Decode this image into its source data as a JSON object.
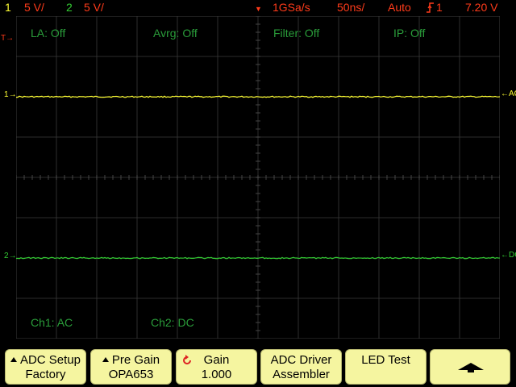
{
  "status": {
    "ch1_num": "1",
    "ch1_scale": "5 V/",
    "ch2_num": "2",
    "ch2_scale": "5 V/",
    "sample_rate": "1GSa/s",
    "timebase": "50ns/",
    "trigger_mode": "Auto",
    "trigger_source": "1",
    "trigger_level": "7.20 V"
  },
  "overlay": {
    "la": "LA: Off",
    "avrg": "Avrg: Off",
    "filter": "Filter: Off",
    "ip": "IP: Off",
    "ch1_coupling": "Ch1: AC",
    "ch2_coupling": "Ch2: DC"
  },
  "markers": {
    "trigger_left": "T",
    "ch1_left": "1",
    "ch2_left": "2",
    "ch1_right": "AC",
    "ch2_right": "DC"
  },
  "traces": [
    {
      "channel": "1",
      "level_div": 2.0,
      "color": "#ffff33"
    },
    {
      "channel": "2",
      "level_div": -2.0,
      "color": "#33cc33"
    }
  ],
  "softkeys": [
    {
      "line1": "ADC Setup",
      "line2": "Factory",
      "icon": "triangle-up-icon"
    },
    {
      "line1": "Pre Gain",
      "line2": "OPA653",
      "icon": "triangle-up-icon"
    },
    {
      "line1": "Gain",
      "line2": "1.000",
      "icon": "rotate-knob-icon"
    },
    {
      "line1": "ADC Driver",
      "line2": "Assembler",
      "icon": ""
    },
    {
      "line1": "LED Test",
      "line2": "",
      "icon": ""
    },
    {
      "line1": "",
      "line2": "",
      "icon": "up-arrow-icon"
    }
  ],
  "colors": {
    "ch1": "#ffff33",
    "ch2": "#33cc33",
    "status_red": "#ff3b1a",
    "grid": "#3a3a3a",
    "overlay_text": "#2a9d3a",
    "softkey_bg": "#f5f5a0"
  }
}
